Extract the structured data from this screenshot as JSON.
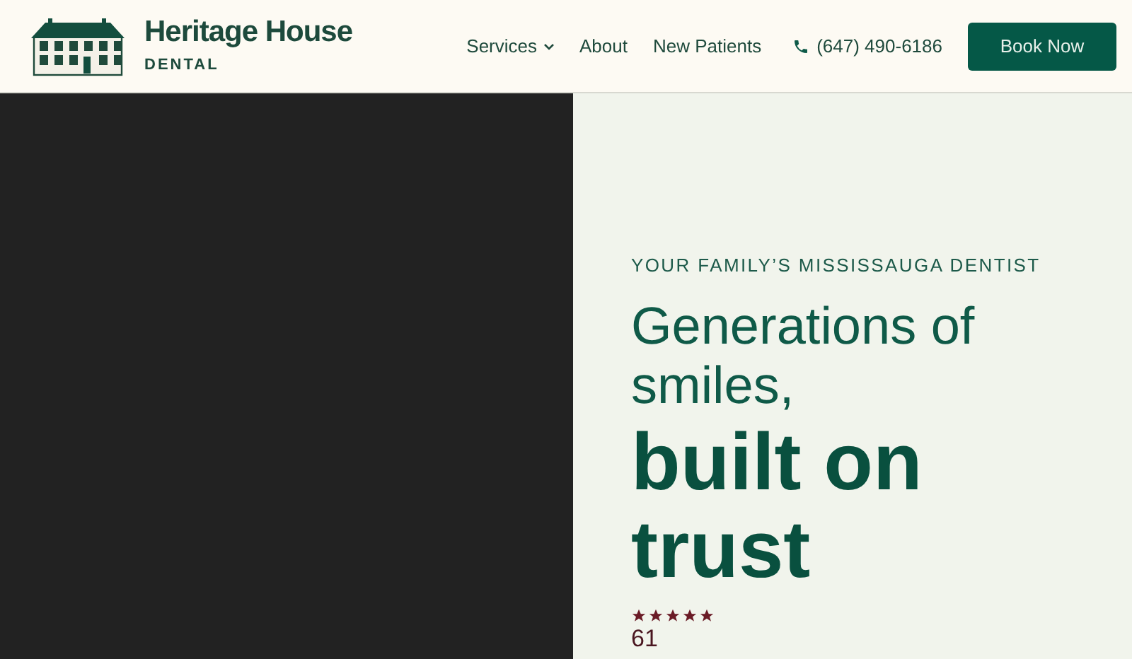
{
  "header": {
    "brand": {
      "name": "Heritage House",
      "subtitle": "DENTAL"
    },
    "nav": [
      {
        "label": "Services",
        "dropdown": true
      },
      {
        "label": "About",
        "dropdown": false
      },
      {
        "label": "New Patients",
        "dropdown": false
      }
    ],
    "phone": "(647) 490-6186",
    "cta": "Book Now"
  },
  "hero": {
    "eyebrow": "YOUR FAMILY’S MISSISSAUGA DENTIST",
    "title_light": "Generations of smiles,",
    "title_bold": "built on trust",
    "stars": 5,
    "review_count": "61"
  }
}
